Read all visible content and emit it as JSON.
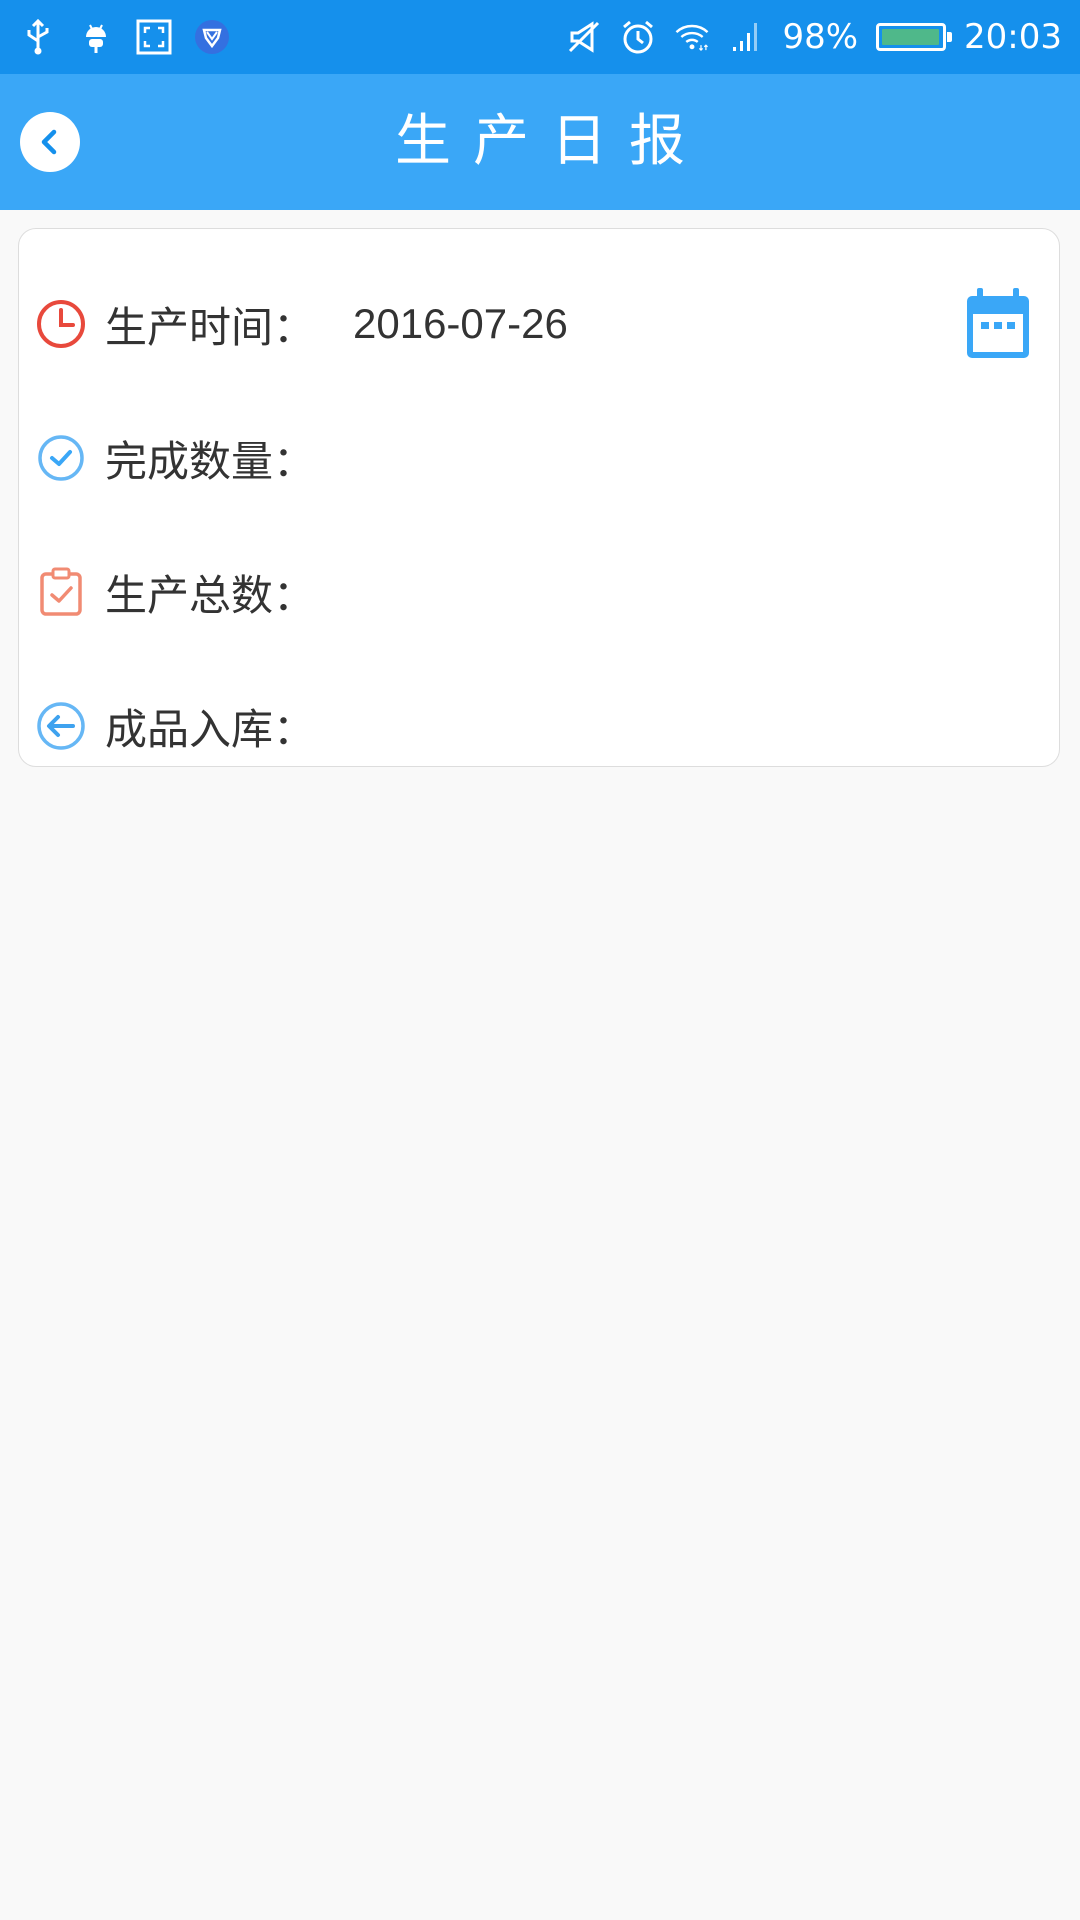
{
  "status_bar": {
    "battery_percent": "98%",
    "battery_level": 0.98,
    "time": "20:03",
    "left_icons": [
      "usb-icon",
      "android-debug-icon",
      "screenshot-icon",
      "shield-app-icon"
    ],
    "right_icons": [
      "mute-icon",
      "alarm-icon",
      "wifi-icon",
      "signal-icon"
    ]
  },
  "nav": {
    "title": "生产日报",
    "back_icon": "chevron-left-icon"
  },
  "form": {
    "rows": [
      {
        "label": "生产时间：",
        "value": "2016-07-26",
        "icon": "clock-icon",
        "icon_color": "#e8493c"
      },
      {
        "label": "完成数量：",
        "value": "",
        "icon": "check-circle-icon",
        "icon_color": "#66b7f5"
      },
      {
        "label": "生产总数：",
        "value": "",
        "icon": "clipboard-check-icon",
        "icon_color": "#f18b73"
      },
      {
        "label": "成品入库：",
        "value": "",
        "icon": "arrow-left-circle-icon",
        "icon_color": "#3ea2ef"
      }
    ],
    "calendar_icon": "calendar-icon"
  },
  "colors": {
    "status_bar": "#1590ec",
    "nav_bar": "#3aa7f7",
    "accent": "#3aa7f7",
    "page_background": "#f9f9f9",
    "text": "#333333"
  }
}
